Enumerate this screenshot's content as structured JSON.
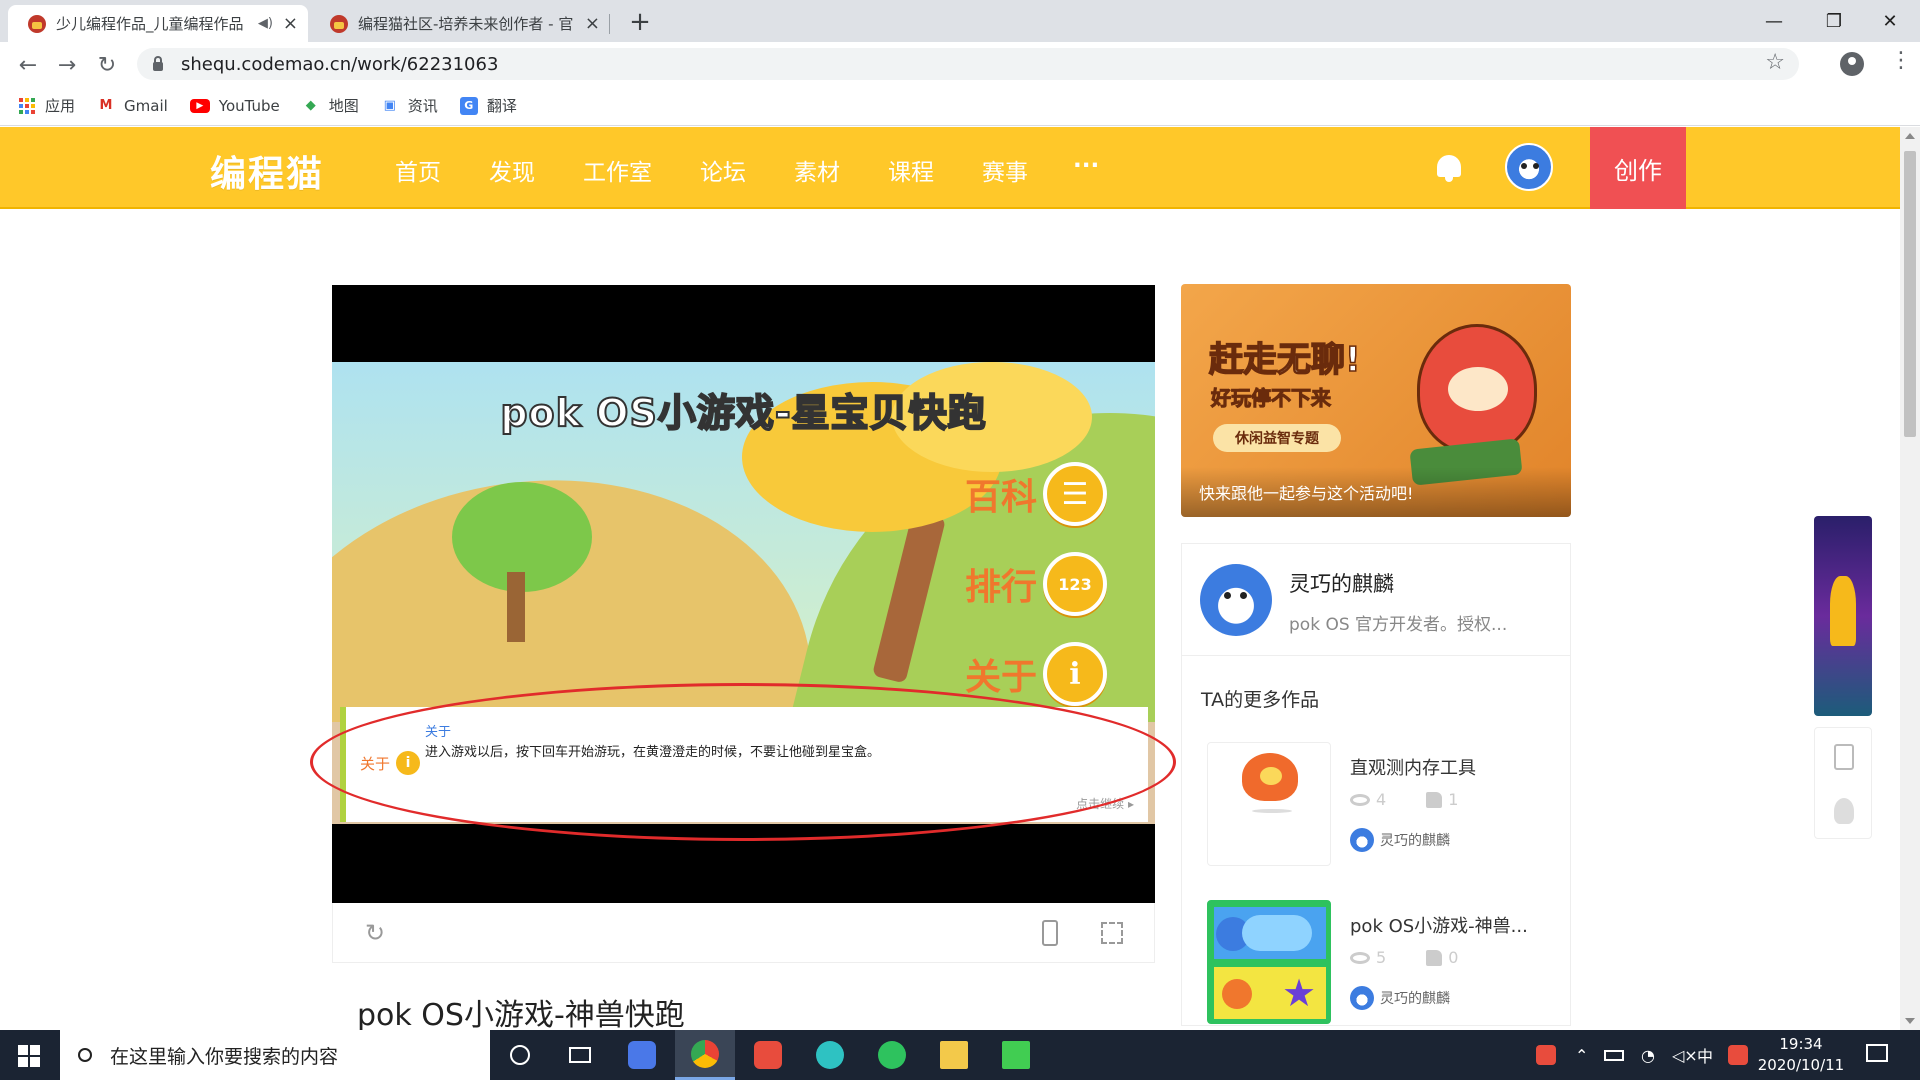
{
  "browser": {
    "tabs": [
      {
        "title": "少儿编程作品_儿童编程作品",
        "active": true,
        "audio_icon": "speaker-icon"
      },
      {
        "title": "编程猫社区-培养未来创作者 - 官",
        "active": false
      }
    ],
    "new_tab": "+",
    "window_controls": {
      "minimize": "—",
      "maximize": "❐",
      "close": "✕"
    },
    "nav": {
      "back": "←",
      "forward": "→",
      "reload": "↻"
    },
    "url": "shequ.codemao.cn/work/62231063",
    "star": "☆",
    "menu": "⋮",
    "bookmarks": [
      {
        "label": "应用",
        "icon": "apps-grid-icon"
      },
      {
        "label": "Gmail",
        "icon": "gmail-icon",
        "glyph": "M",
        "color": "#d93025"
      },
      {
        "label": "YouTube",
        "icon": "youtube-icon",
        "glyph": "▶",
        "color": "#ff0000"
      },
      {
        "label": "地图",
        "icon": "maps-icon",
        "glyph": "◆",
        "color": "#34a853"
      },
      {
        "label": "资讯",
        "icon": "news-icon",
        "glyph": "▣",
        "color": "#4285f4"
      },
      {
        "label": "翻译",
        "icon": "translate-icon",
        "glyph": "G",
        "color": "#4285f4"
      }
    ]
  },
  "site": {
    "logo": "编程猫",
    "nav": [
      "首页",
      "发现",
      "工作室",
      "论坛",
      "素材",
      "课程",
      "赛事",
      "···"
    ],
    "create_label": "创作",
    "colors": {
      "brand_yellow": "#ffc829",
      "create_red": "#f05053"
    }
  },
  "game": {
    "title": "pok OS小游戏-星宝贝快跑",
    "menu": [
      {
        "label": "百科",
        "glyph": "☰"
      },
      {
        "label": "排行",
        "glyph": "123"
      },
      {
        "label": "关于",
        "glyph": "i"
      }
    ],
    "dialog": {
      "side_label": "关于",
      "side_glyph": "i",
      "title": "关于",
      "text": "进入游戏以后，按下回车开始游玩，在黄澄澄走的时候，不要让他碰到星宝盒。",
      "more": "点击继续 ▸"
    }
  },
  "player_controls": {
    "restart": "↻"
  },
  "work": {
    "title": "pok OS小游戏-神兽快跑"
  },
  "banner": {
    "headline": "赶走无聊!",
    "sub": "好玩停不下来",
    "tag": "休闲益智专题",
    "caption": "快来跟他一起参与这个活动吧!"
  },
  "author": {
    "name": "灵巧的麒麟",
    "bio": "pok OS 官方开发者。授权..."
  },
  "more_works": {
    "title": "TA的更多作品",
    "items": [
      {
        "name": "直观测内存工具",
        "views": "4",
        "likes": "1",
        "author": "灵巧的麒麟"
      },
      {
        "name": "pok OS小游戏-神兽...",
        "views": "5",
        "likes": "0",
        "author": "灵巧的麒麟"
      }
    ]
  },
  "taskbar": {
    "search_placeholder": "在这里输入你要搜索的内容",
    "ime": "中",
    "time": "19:34",
    "date": "2020/10/11"
  }
}
